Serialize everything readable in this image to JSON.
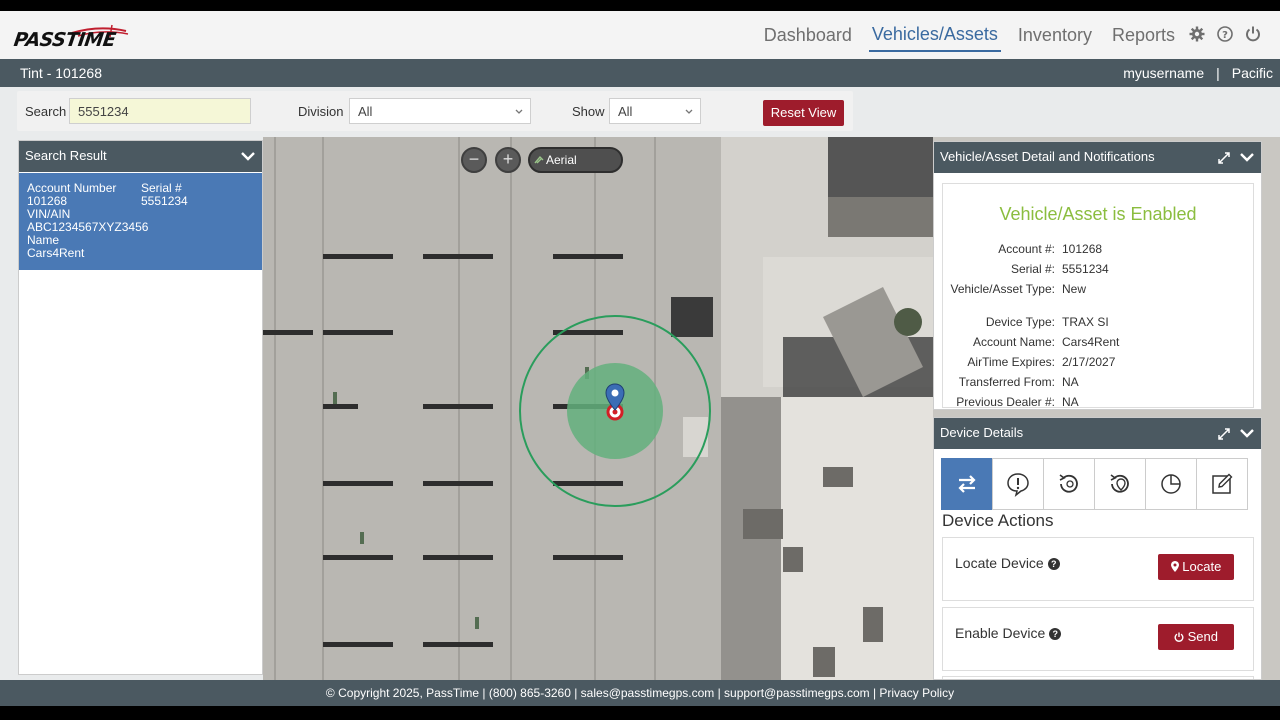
{
  "header": {
    "logo_text": "PASSTIME",
    "nav": [
      {
        "label": "Dashboard",
        "active": false
      },
      {
        "label": "Vehicles/Assets",
        "active": true
      },
      {
        "label": "Inventory",
        "active": false
      },
      {
        "label": "Reports",
        "active": false
      }
    ],
    "icons": [
      "gear-icon",
      "help-icon",
      "power-icon"
    ]
  },
  "subbar": {
    "title": "Tint - 101268",
    "username": "myusername",
    "separator": "|",
    "timezone": "Pacific"
  },
  "filters": {
    "search_label": "Search",
    "search_value": "5551234",
    "division_label": "Division",
    "division_value": "All",
    "show_label": "Show",
    "show_value": "All",
    "reset_label": "Reset View"
  },
  "search_result": {
    "title": "Search Result",
    "account_number_label": "Account Number",
    "account_number": "101268",
    "vin_label": "VIN/AIN",
    "vin": "ABC1234567XYZ3456",
    "name_label": "Name",
    "name": "Cars4Rent",
    "serial_label": "Serial #",
    "serial": "5551234"
  },
  "map": {
    "zoom_out": "−",
    "zoom_in": "+",
    "layer_label": "Aerial"
  },
  "detail": {
    "title": "Vehicle/Asset Detail and Notifications",
    "status": "Vehicle/Asset is Enabled",
    "fields": [
      {
        "k": "Account #:",
        "v": "101268"
      },
      {
        "k": "Serial #:",
        "v": "5551234"
      },
      {
        "k": "Vehicle/Asset Type:",
        "v": "New"
      },
      {
        "k": "Device Type:",
        "v": "TRAX SI"
      },
      {
        "k": "Account Name:",
        "v": "Cars4Rent"
      },
      {
        "k": "AirTime Expires:",
        "v": "2/17/2027"
      },
      {
        "k": "Transferred From:",
        "v": "NA"
      },
      {
        "k": "Previous Dealer #:",
        "v": "NA"
      }
    ]
  },
  "device": {
    "title": "Device Details",
    "actions_title": "Device Actions",
    "locate_label": "Locate Device",
    "locate_btn": "Locate",
    "enable_label": "Enable Device",
    "enable_btn": "Send"
  },
  "footer": {
    "text": "© Copyright 2025, PassTime | (800) 865-3260 | sales@passtimegps.com | support@passtimegps.com | Privacy Policy"
  },
  "colors": {
    "header_dark": "#4b5961",
    "accent_blue": "#4a79b5",
    "button_red": "#9e1c2c",
    "enabled_green": "#8bbd3f"
  }
}
